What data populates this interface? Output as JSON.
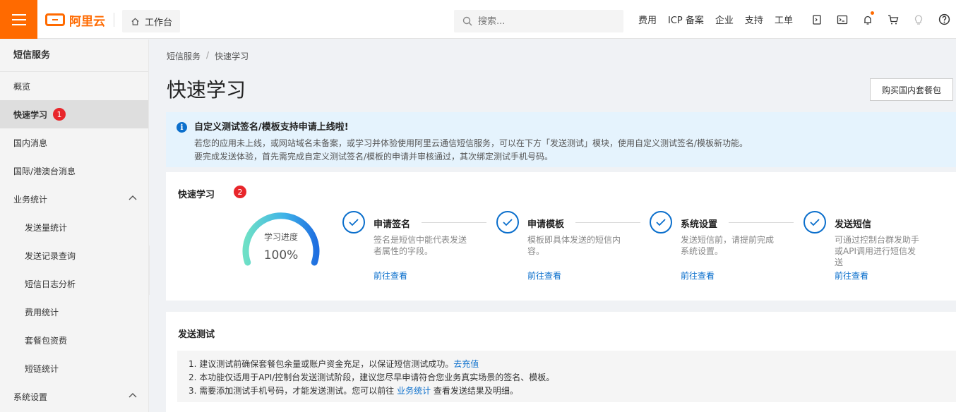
{
  "header": {
    "logo_text": "阿里云",
    "workbench_label": "工作台",
    "search_placeholder": "搜索...",
    "links": [
      "费用",
      "ICP 备案",
      "企业",
      "支持",
      "工单"
    ],
    "accent": "#ff6a00"
  },
  "sidebar": {
    "title": "短信服务",
    "items": [
      {
        "label": "概览"
      },
      {
        "label": "快速学习",
        "badge": "1"
      },
      {
        "label": "国内消息"
      },
      {
        "label": "国际/港澳台消息"
      },
      {
        "label": "业务统计"
      },
      {
        "label": "发送量统计"
      },
      {
        "label": "发送记录查询"
      },
      {
        "label": "短信日志分析"
      },
      {
        "label": "费用统计"
      },
      {
        "label": "套餐包资费"
      },
      {
        "label": "短链统计"
      },
      {
        "label": "系统设置"
      }
    ]
  },
  "breadcrumb": [
    "短信服务",
    "快速学习"
  ],
  "page": {
    "title": "快速学习",
    "buy_button": "购买国内套餐包"
  },
  "notice": {
    "title": "自定义测试签名/模板支持申请上线啦!",
    "line1": "若您的应用未上线，或网站域名未备案，或学习并体验使用阿里云通信短信服务，可以在下方「发送测试」模块，使用自定义测试签名/模板新功能。",
    "line2": "要完成发送体验，首先需完成自定义测试签名/模板的申请并审核通过，其次绑定测试手机号码。"
  },
  "learn": {
    "title": "快速学习",
    "badge": "2",
    "progress_label": "学习进度",
    "progress_value": "100%",
    "progress_fraction": 1.0,
    "steps": [
      {
        "title": "申请签名",
        "desc": "签名是短信中能代表发送者属性的字段。",
        "link": "前往查看"
      },
      {
        "title": "申请模板",
        "desc": "模板即具体发送的短信内容。",
        "link": "前往查看"
      },
      {
        "title": "系统设置",
        "desc": "发送短信前，请提前完成系统设置。",
        "link": "前往查看"
      },
      {
        "title": "发送短信",
        "desc": "可通过控制台群发助手或API调用进行短信发送",
        "link": "前往查看"
      }
    ]
  },
  "test": {
    "title": "发送测试",
    "tip1": "1. 建议测试前确保套餐包余量或账户资金充足，以保证短信测试成功。",
    "tip1_link": "去充值",
    "tip2": "2. 本功能仅适用于API/控制台发送测试阶段，建议您尽早申请符合您业务真实场景的签名、模板。",
    "tip3_a": "3. 需要添加测试手机号码，才能发送测试。您可以前往 ",
    "tip3_link": "业务统计",
    "tip3_b": " 查看发送结果及明细。"
  }
}
